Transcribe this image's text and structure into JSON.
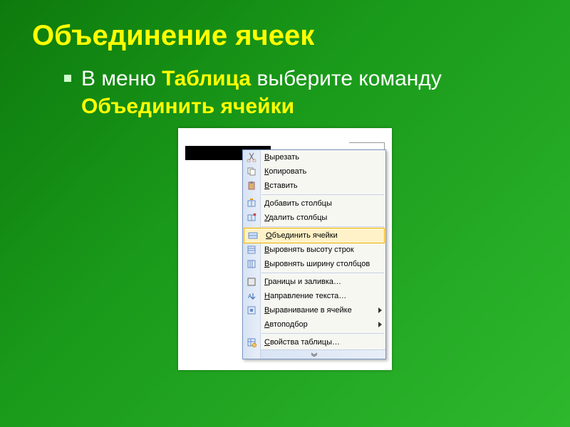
{
  "title": "Объединение ячеек",
  "instruction": {
    "prefix": "В меню ",
    "menu_name": "Таблица",
    "mid": " выберите команду ",
    "command": "Объединить ячейки"
  },
  "context_menu": {
    "items": [
      {
        "icon": "cut",
        "label": "Вырезать",
        "sep": false,
        "sub": false,
        "hl": false
      },
      {
        "icon": "copy",
        "label": "Копировать",
        "sep": false,
        "sub": false,
        "hl": false
      },
      {
        "icon": "paste",
        "label": "Вставить",
        "sep": true,
        "sub": false,
        "hl": false
      },
      {
        "icon": "add-col",
        "label": "Добавить столбцы",
        "sep": false,
        "sub": false,
        "hl": false
      },
      {
        "icon": "del-col",
        "label": "Удалить столбцы",
        "sep": true,
        "sub": false,
        "hl": false
      },
      {
        "icon": "merge",
        "label": "Объединить ячейки",
        "sep": false,
        "sub": false,
        "hl": true
      },
      {
        "icon": "row-h",
        "label": "Выровнять высоту строк",
        "sep": false,
        "sub": false,
        "hl": false
      },
      {
        "icon": "col-w",
        "label": "Выровнять ширину столбцов",
        "sep": true,
        "sub": false,
        "hl": false
      },
      {
        "icon": "borders",
        "label": "Границы и заливка…",
        "sep": false,
        "sub": false,
        "hl": false
      },
      {
        "icon": "text-dir",
        "label": "Направление текста…",
        "sep": false,
        "sub": false,
        "hl": false
      },
      {
        "icon": "align",
        "label": "Выравнивание в ячейке",
        "sep": false,
        "sub": true,
        "hl": false
      },
      {
        "icon": "none",
        "label": "Автоподбор",
        "sep": true,
        "sub": true,
        "hl": false
      },
      {
        "icon": "props",
        "label": "Свойства таблицы…",
        "sep": false,
        "sub": false,
        "hl": false
      }
    ]
  }
}
